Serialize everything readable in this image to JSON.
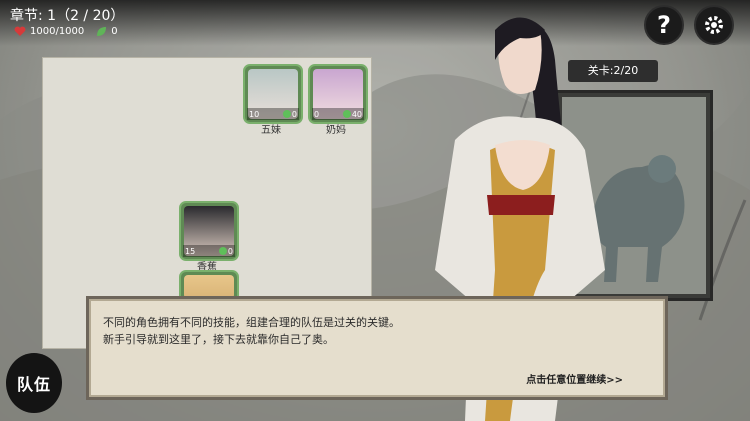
{
  "hud": {
    "chapter": "章节: 1（2 / 20）",
    "hp": "1000/1000",
    "leaf_count": "0"
  },
  "top_buttons": {
    "help": "?",
    "settings_icon": "gear-icon"
  },
  "team_cards": [
    {
      "name": "五妹",
      "atk": "10",
      "def": "0"
    },
    {
      "name": "奶妈",
      "atk": "0",
      "def": "40"
    },
    {
      "name": "香蕉",
      "atk": "15",
      "def": "0"
    }
  ],
  "level": {
    "label": "关卡:2/20"
  },
  "dialog": {
    "line1": "不同的角色拥有不同的技能，组建合理的队伍是过关的关键。",
    "line2": "新手引导就到这里了，接下去就靠你自己了奥。",
    "continue": "点击任意位置继续>>"
  },
  "team_button": "队伍",
  "colors": {
    "card_border": "#7ab06c",
    "dialog_bg": "#e5decd",
    "dark": "#1b1b1b"
  }
}
